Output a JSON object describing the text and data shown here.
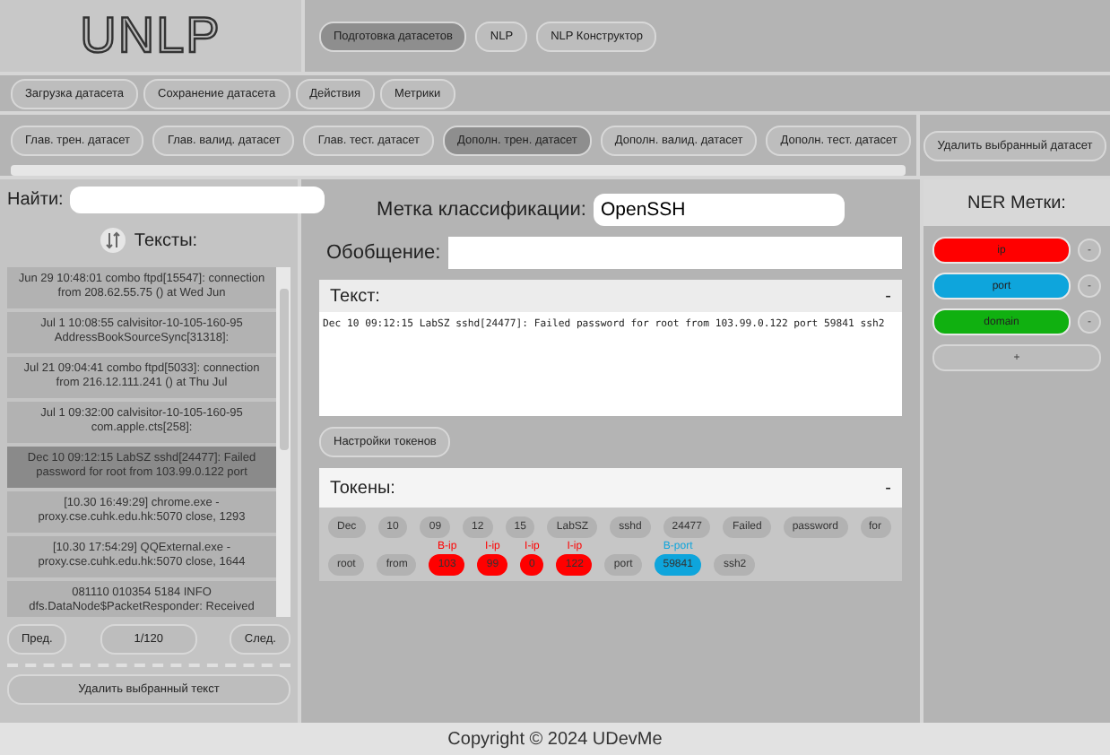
{
  "logo": "UNLP",
  "nav_tabs": [
    {
      "label": "Подготовка датасетов",
      "selected": true
    },
    {
      "label": "NLP",
      "selected": false
    },
    {
      "label": "NLP Конструктор",
      "selected": false
    }
  ],
  "menu": [
    "Загрузка датасета",
    "Сохранение датасета",
    "Действия",
    "Метрики"
  ],
  "dataset_tabs": [
    {
      "label": "Глав. трен. датасет",
      "selected": false
    },
    {
      "label": "Глав. валид. датасет",
      "selected": false
    },
    {
      "label": "Глав. тест. датасет",
      "selected": false
    },
    {
      "label": "Дополн. трен. датасет",
      "selected": true
    },
    {
      "label": "Дополн. валид. датасет",
      "selected": false
    },
    {
      "label": "Дополн. тест. датасет",
      "selected": false
    }
  ],
  "delete_dataset": "Удалить выбранный датасет",
  "search": {
    "label": "Найти:"
  },
  "texts_title": "Тексты:",
  "texts": [
    {
      "text": "Jun 29 10:48:01 combo ftpd[15547]: connection from 208.62.55.75 () at Wed Jun",
      "selected": false
    },
    {
      "text": "Jul 1 10:08:55 calvisitor-10-105-160-95 AddressBookSourceSync[31318]:",
      "selected": false
    },
    {
      "text": "Jul 21 09:04:41 combo ftpd[5033]: connection from 216.12.111.241 () at Thu Jul",
      "selected": false
    },
    {
      "text": "Jul 1 09:32:00 calvisitor-10-105-160-95 com.apple.cts[258]:",
      "selected": false
    },
    {
      "text": "Dec 10 09:12:15 LabSZ sshd[24477]: Failed password for root from 103.99.0.122 port",
      "selected": true
    },
    {
      "text": "[10.30 16:49:29] chrome.exe - proxy.cse.cuhk.edu.hk:5070 close, 1293",
      "selected": false
    },
    {
      "text": "[10.30 17:54:29] QQExternal.exe - proxy.cse.cuhk.edu.hk:5070 close, 1644",
      "selected": false
    },
    {
      "text": "081110 010354 5184 INFO dfs.DataNode$PacketResponder: Received",
      "selected": false
    }
  ],
  "pager": {
    "prev": "Пред.",
    "page": "1/120",
    "next": "След."
  },
  "delete_text": "Удалить выбранный текст",
  "class_label": {
    "label": "Метка классификации:",
    "value": "OpenSSH"
  },
  "summary": {
    "label": "Обобщение:"
  },
  "text_section": {
    "title": "Текст:",
    "toggle": "-",
    "body": "Dec 10 09:12:15 LabSZ sshd[24477]: Failed password for root from 103.99.0.122 port 59841 ssh2"
  },
  "token_settings": "Настройки токенов",
  "tokens_section": {
    "title": "Токены:",
    "toggle": "-"
  },
  "tokens": [
    [
      {
        "text": "Dec"
      },
      {
        "text": "10"
      },
      {
        "text": "09"
      },
      {
        "text": "12"
      },
      {
        "text": "15"
      },
      {
        "text": "LabSZ"
      },
      {
        "text": "sshd"
      },
      {
        "text": "24477"
      },
      {
        "text": "Failed"
      },
      {
        "text": "password"
      },
      {
        "text": "for"
      }
    ],
    [
      {
        "text": "root"
      },
      {
        "text": "from"
      },
      {
        "text": "103",
        "tag": "B-ip",
        "color": "#ff0000"
      },
      {
        "text": "99",
        "tag": "I-ip",
        "color": "#ff0000"
      },
      {
        "text": "0",
        "tag": "I-ip",
        "color": "#ff0000"
      },
      {
        "text": "122",
        "tag": "I-ip",
        "color": "#ff0000"
      },
      {
        "text": "port"
      },
      {
        "text": "59841",
        "tag": "B-port",
        "color": "#0ea5dc"
      },
      {
        "text": "ssh2"
      }
    ]
  ],
  "ner": {
    "title": "NER Метки:",
    "labels": [
      {
        "name": "ip",
        "color": "#ff0000",
        "remove": "-"
      },
      {
        "name": "port",
        "color": "#0ea5dc",
        "remove": "-"
      },
      {
        "name": "domain",
        "color": "#10b010",
        "remove": "-"
      }
    ],
    "add": "+"
  },
  "footer": "Copyright © 2024 UDevMe"
}
